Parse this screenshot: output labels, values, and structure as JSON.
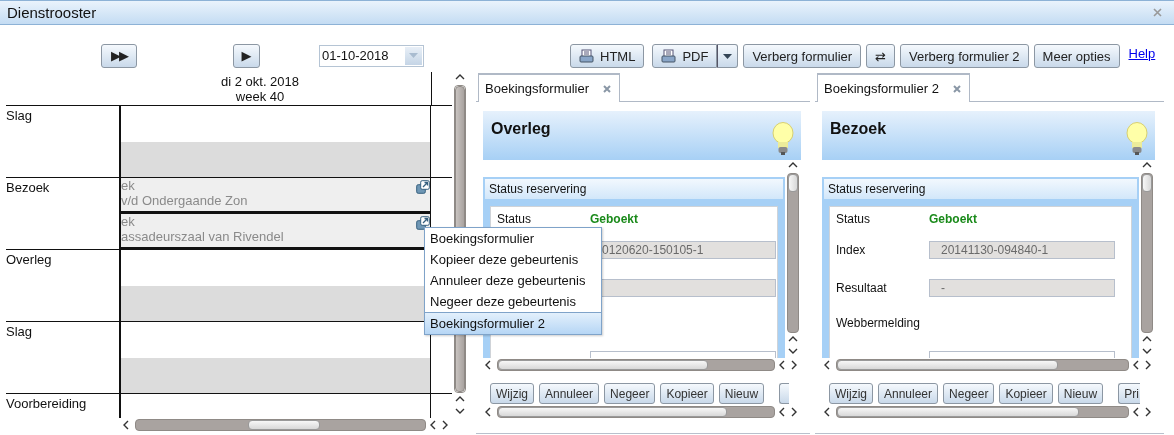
{
  "window": {
    "title": "Dienstrooster"
  },
  "schedule": {
    "nav_buttons": [
      {
        "label": "▶▶"
      },
      {
        "label": "▶"
      }
    ],
    "date_field": {
      "value": "01-10-2018"
    },
    "day_header": {
      "date": "di 2 okt. 2018",
      "week": "week 40"
    },
    "rows": [
      {
        "label": "Slag"
      },
      {
        "label": "Bezoek",
        "events": [
          {
            "lines": [
              "ek",
              "v/d Ondergaande Zon"
            ]
          },
          {
            "lines": [
              "ek",
              "assadeurszaal van Rivendel"
            ]
          }
        ]
      },
      {
        "label": "Overleg"
      },
      {
        "label": "Slag"
      },
      {
        "label": "Voorbereiding"
      }
    ]
  },
  "context_menu": {
    "items": [
      {
        "label": "Boekingsformulier",
        "selected": false
      },
      {
        "label": "Kopieer deze gebeurtenis",
        "selected": false
      },
      {
        "label": "Annuleer deze gebeurtenis",
        "selected": false
      },
      {
        "label": "Negeer deze gebeurtenis",
        "selected": false
      },
      {
        "label": "Boekingsformulier 2",
        "selected": true
      }
    ]
  },
  "toolbar": {
    "buttons": [
      {
        "label": "HTML",
        "kind": "print"
      },
      {
        "label": "PDF",
        "kind": "split"
      },
      {
        "label": "Verberg formulier",
        "kind": "plain"
      },
      {
        "label": "⇄",
        "kind": "plain"
      },
      {
        "label": "Verberg formulier 2",
        "kind": "plain"
      },
      {
        "label": "Meer opties",
        "kind": "plain"
      }
    ],
    "help_link": "Help"
  },
  "forms": [
    {
      "tab": {
        "label": "Boekingsformulier",
        "selected": true
      },
      "title": "Overleg",
      "section": "Status reservering",
      "fields": [
        {
          "kind": "status",
          "label": "Status",
          "value": "Geboekt"
        },
        {
          "kind": "input",
          "value": "0120620-150105-1"
        },
        {
          "kind": "input"
        },
        {
          "kind": "label"
        },
        {
          "kind": "input_cut"
        }
      ],
      "buttons": [
        {
          "label": "Wijzig",
          "kind": "full"
        },
        {
          "label": "Annuleer",
          "kind": "full"
        },
        {
          "label": "Negeer",
          "kind": "full"
        },
        {
          "label": "Kopieer",
          "kind": "full"
        },
        {
          "label": "Nieuw",
          "kind": "full"
        },
        {
          "kind": "cut"
        }
      ]
    },
    {
      "tab": {
        "label": "Boekingsformulier 2",
        "selected": true
      },
      "title": "Bezoek",
      "section": "Status reservering",
      "fields": [
        {
          "kind": "status",
          "label": "Status",
          "value": "Geboekt"
        },
        {
          "kind": "input",
          "label": "Index",
          "value": "20141130-094840-1"
        },
        {
          "kind": "input",
          "label": "Resultaat",
          "value": "-"
        },
        {
          "kind": "label",
          "label": "Webbermelding"
        },
        {
          "kind": "input_cut"
        }
      ],
      "buttons": [
        {
          "label": "Wijzig",
          "kind": "full"
        },
        {
          "label": "Annuleer",
          "kind": "full"
        },
        {
          "label": "Negeer",
          "kind": "full"
        },
        {
          "label": "Kopieer",
          "kind": "full"
        },
        {
          "label": "Nieuw",
          "kind": "full"
        },
        {
          "label": "Pri",
          "kind": "cut"
        }
      ]
    }
  ]
}
